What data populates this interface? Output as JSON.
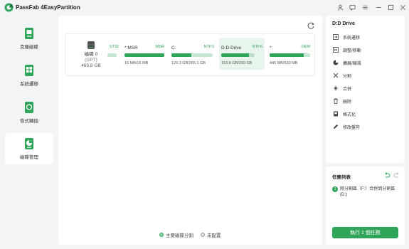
{
  "app": {
    "title": "PassFab 4EasyPartition"
  },
  "sidebar": {
    "items": [
      {
        "label": "克隆磁碟",
        "icon": "disk-clone-icon"
      },
      {
        "label": "系統遷移",
        "icon": "system-migrate-icon"
      },
      {
        "label": "恢式轉換",
        "icon": "format-convert-icon"
      },
      {
        "label": "磁碟管理",
        "icon": "disk-manage-icon"
      }
    ]
  },
  "disk": {
    "name": "磁碟 0",
    "type": "(GPT)",
    "size": "465.8 GB"
  },
  "partitions": [
    {
      "label": "",
      "fs": "ST32",
      "capacity": "",
      "fill": 0.0
    },
    {
      "label": "*:MSR",
      "fs": "MSR",
      "capacity": "16 MB/16 MB",
      "fill": 1.0
    },
    {
      "label": "C:",
      "fs": "NTFS",
      "capacity": "129.3 GB/265.1 GB",
      "fill": 0.49
    },
    {
      "label": "D:D Drive",
      "fs": "NTFS",
      "capacity": "163.8 GB/200 GB",
      "fill": 0.82
    },
    {
      "label": "*:",
      "fs": "OEM",
      "capacity": "445 MB/530 MB",
      "fill": 0.84
    }
  ],
  "legend": {
    "primary": "主要磁碟分割",
    "unallocated": "未配置"
  },
  "actions_panel": {
    "title": "D:D Drive",
    "items": [
      {
        "label": "系統遷移",
        "icon": "migrate-icon"
      },
      {
        "label": "調整/移動",
        "icon": "resize-icon"
      },
      {
        "label": "擴展/縮減",
        "icon": "extend-icon"
      },
      {
        "label": "分割",
        "icon": "split-icon"
      },
      {
        "label": "合併",
        "icon": "merge-icon"
      },
      {
        "label": "刪除",
        "icon": "delete-icon"
      },
      {
        "label": "格式化",
        "icon": "format-icon"
      },
      {
        "label": "修改盤符",
        "icon": "edit-letter-icon"
      }
    ]
  },
  "tasks": {
    "title": "任務列表",
    "items": [
      {
        "number": "1",
        "text": "將分割區（F:）合併到分割區 (D:)"
      }
    ],
    "execute_label": "執行 1 個任務"
  },
  "colors": {
    "accent": "#2fa55a",
    "background": "#f2f4f6"
  }
}
